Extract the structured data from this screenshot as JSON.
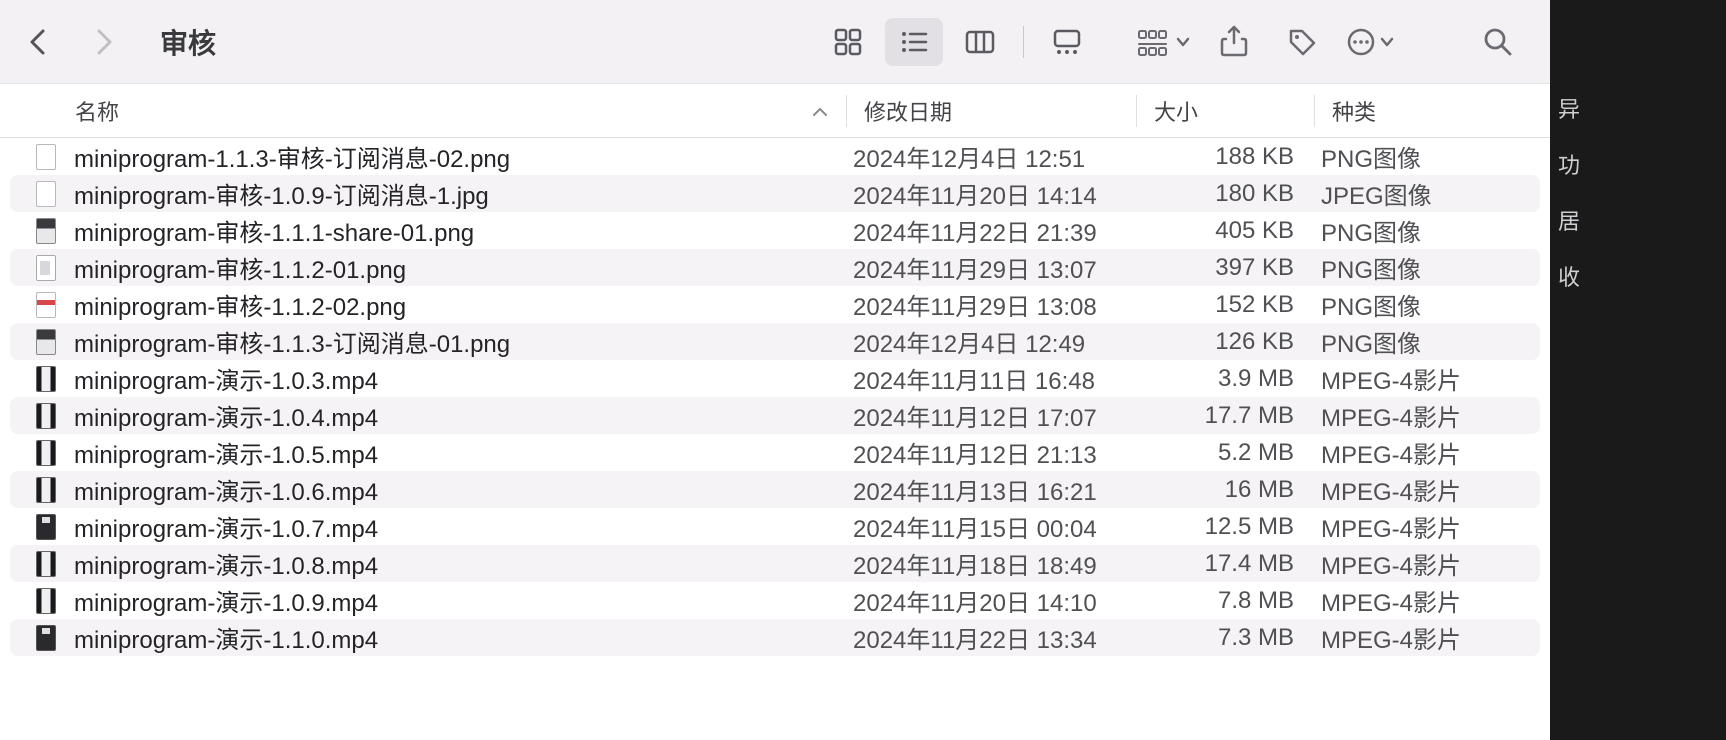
{
  "window": {
    "title": "审核"
  },
  "columns": {
    "name": "名称",
    "date": "修改日期",
    "size": "大小",
    "kind": "种类"
  },
  "files": [
    {
      "name": "miniprogram-1.1.3-审核-订阅消息-02.png",
      "date": "2024年12月4日 12:51",
      "size": "188 KB",
      "kind": "PNG图像",
      "icon": "image-white"
    },
    {
      "name": "miniprogram-审核-1.0.9-订阅消息-1.jpg",
      "date": "2024年11月20日 14:14",
      "size": "180 KB",
      "kind": "JPEG图像",
      "icon": "image-white"
    },
    {
      "name": "miniprogram-审核-1.1.1-share-01.png",
      "date": "2024年11月22日 21:39",
      "size": "405 KB",
      "kind": "PNG图像",
      "icon": "image-dark"
    },
    {
      "name": "miniprogram-审核-1.1.2-01.png",
      "date": "2024年11月29日 13:07",
      "size": "397 KB",
      "kind": "PNG图像",
      "icon": "image-small"
    },
    {
      "name": "miniprogram-审核-1.1.2-02.png",
      "date": "2024年11月29日 13:08",
      "size": "152 KB",
      "kind": "PNG图像",
      "icon": "image-stripe"
    },
    {
      "name": "miniprogram-审核-1.1.3-订阅消息-01.png",
      "date": "2024年12月4日 12:49",
      "size": "126 KB",
      "kind": "PNG图像",
      "icon": "image-dark"
    },
    {
      "name": "miniprogram-演示-1.0.3.mp4",
      "date": "2024年11月11日 16:48",
      "size": "3.9 MB",
      "kind": "MPEG-4影片",
      "icon": "video"
    },
    {
      "name": "miniprogram-演示-1.0.4.mp4",
      "date": "2024年11月12日 17:07",
      "size": "17.7 MB",
      "kind": "MPEG-4影片",
      "icon": "video"
    },
    {
      "name": "miniprogram-演示-1.0.5.mp4",
      "date": "2024年11月12日 21:13",
      "size": "5.2 MB",
      "kind": "MPEG-4影片",
      "icon": "video"
    },
    {
      "name": "miniprogram-演示-1.0.6.mp4",
      "date": "2024年11月13日 16:21",
      "size": "16 MB",
      "kind": "MPEG-4影片",
      "icon": "video"
    },
    {
      "name": "miniprogram-演示-1.0.7.mp4",
      "date": "2024年11月15日 00:04",
      "size": "12.5 MB",
      "kind": "MPEG-4影片",
      "icon": "video-dark"
    },
    {
      "name": "miniprogram-演示-1.0.8.mp4",
      "date": "2024年11月18日 18:49",
      "size": "17.4 MB",
      "kind": "MPEG-4影片",
      "icon": "video"
    },
    {
      "name": "miniprogram-演示-1.0.9.mp4",
      "date": "2024年11月20日 14:10",
      "size": "7.8 MB",
      "kind": "MPEG-4影片",
      "icon": "video"
    },
    {
      "name": "miniprogram-演示-1.1.0.mp4",
      "date": "2024年11月22日 13:34",
      "size": "7.3 MB",
      "kind": "MPEG-4影片",
      "icon": "video-dark"
    }
  ],
  "sidebar": {
    "items": [
      "异",
      "功",
      "居",
      "收"
    ]
  }
}
